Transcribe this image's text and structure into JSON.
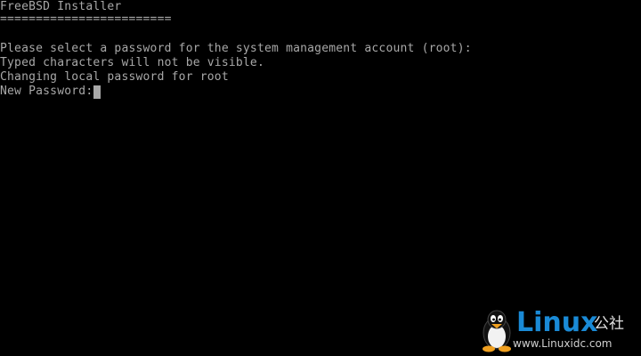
{
  "terminal": {
    "title": "FreeBSD Installer",
    "underline": "========================",
    "lines": [
      "Please select a password for the system management account (root):",
      "Typed characters will not be visible.",
      "Changing local password for root"
    ],
    "prompt_label": "New Password:",
    "password_value": ""
  },
  "watermark": {
    "brand": "Linux",
    "brand_cn": "公社",
    "url": "www.Linuxidc.com",
    "logo_icon": "tux-penguin-icon"
  },
  "colors": {
    "background": "#000000",
    "text": "#a8a8a8",
    "brand": "#1a8ad6"
  }
}
